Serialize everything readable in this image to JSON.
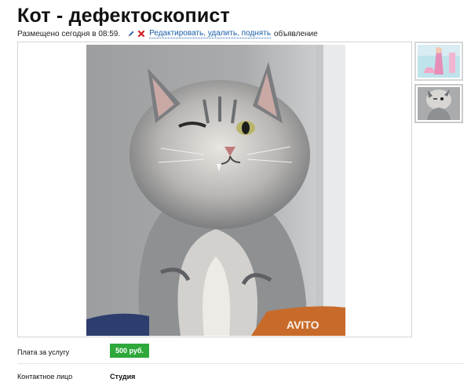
{
  "listing": {
    "title": "Кот - дефектоскопист",
    "posted_text": "Размещено сегодня в 08:59.",
    "edit_link": "Редактировать, удалить, поднять",
    "edit_suffix": "объявление"
  },
  "gallery": {
    "watermark": "AVITO",
    "thumbnails": [
      "thumb-pink-figure",
      "thumb-cat"
    ]
  },
  "details": {
    "price_label": "Плата за услугу",
    "price_value": "500 руб.",
    "contact_label": "Контактное лицо",
    "contact_value": "Студия"
  },
  "colors": {
    "price_badge": "#2ea83a",
    "link": "#1a5fa8"
  }
}
